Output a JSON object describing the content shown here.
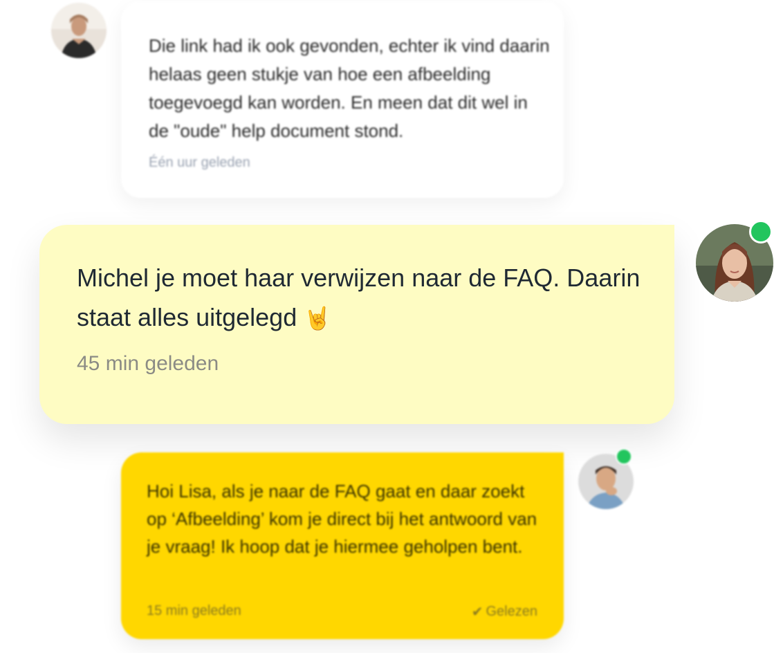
{
  "messages": [
    {
      "author_side": "left",
      "text": "Die link had ik ook gevonden, echter ik vind daarin helaas geen stukje van hoe een afbeelding toegevoegd kan worden. En meen dat dit wel in de \"oude\" help document stond.",
      "time": "Één uur geleden",
      "bubble_color": "#ffffff",
      "online": false
    },
    {
      "author_side": "right",
      "text": "Michel je moet haar verwijzen naar de FAQ. Daarin staat alles uitgelegd",
      "emoji": "🤘",
      "time": "45 min geleden",
      "bubble_color": "#fefcc3",
      "online": true
    },
    {
      "author_side": "right",
      "text": "Hoi Lisa, als je naar de FAQ gaat en daar zoekt op ‘Afbeelding’ kom je direct bij het antwoord van je vraag! Ik hoop dat je hiermee geholpen bent.",
      "time": "15 min geleden",
      "status": "Gelezen",
      "status_icon": "check-icon",
      "bubble_color": "#ffd700",
      "online": true
    }
  ],
  "colors": {
    "online_indicator": "#22c55e",
    "background": "#ffffff"
  }
}
